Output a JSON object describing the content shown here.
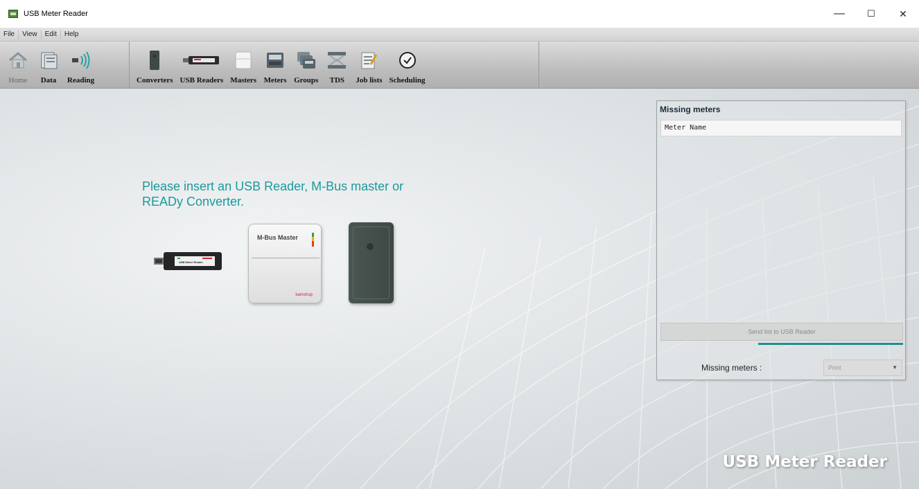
{
  "window": {
    "title": "USB Meter Reader",
    "controls": {
      "minimize": "—",
      "maximize": "☐",
      "close": "✕"
    }
  },
  "menu": [
    "File",
    "View",
    "Edit",
    "Help"
  ],
  "toolbar": {
    "nav": [
      {
        "label": "Home",
        "icon": "home-icon"
      },
      {
        "label": "Data",
        "icon": "data-icon"
      },
      {
        "label": "Reading",
        "icon": "reading-icon"
      }
    ],
    "items": [
      {
        "label": "Converters",
        "icon": "converter-icon"
      },
      {
        "label": "USB Readers",
        "icon": "usb-reader-icon"
      },
      {
        "label": "Masters",
        "icon": "master-icon"
      },
      {
        "label": "Meters",
        "icon": "meter-icon"
      },
      {
        "label": "Groups",
        "icon": "groups-icon"
      },
      {
        "label": "TDS",
        "icon": "tds-icon"
      },
      {
        "label": "Job lists",
        "icon": "job-list-icon"
      },
      {
        "label": "Scheduling",
        "icon": "clock-icon"
      }
    ]
  },
  "main": {
    "prompt": "Please insert an USB Reader, M-Bus master or READy Converter.",
    "devices": {
      "usb_reader_label": "USB Meter Reader",
      "mbus_label": "M-Bus Master",
      "mbus_brand": "kamstrup"
    }
  },
  "missing_meters": {
    "title": "Missing meters",
    "column_header": "Meter Name",
    "send_button": "Send list to USB Reader",
    "footer_label": "Missing meters :",
    "print_option": "Print"
  },
  "watermark": "USB Meter Reader",
  "colors": {
    "accent": "#1a9a9a",
    "progress": "#1e8f8c"
  }
}
